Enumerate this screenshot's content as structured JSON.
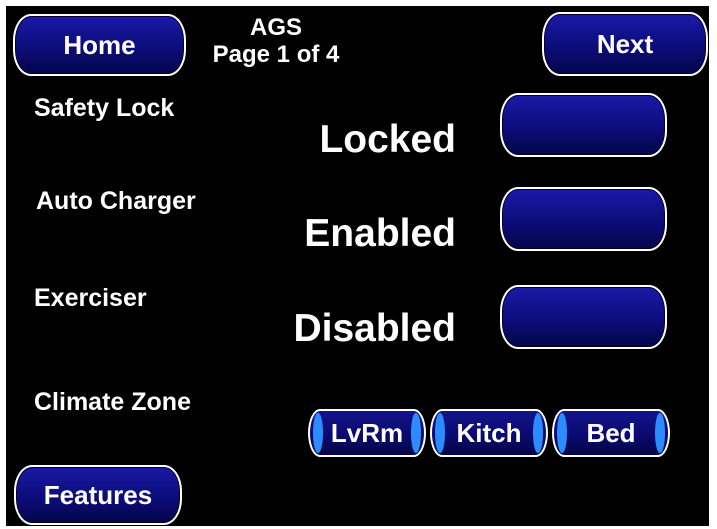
{
  "header": {
    "title": "AGS",
    "page_indicator": "Page 1 of 4",
    "home_label": "Home",
    "next_label": "Next"
  },
  "settings": [
    {
      "label": "Safety Lock",
      "status": "Locked"
    },
    {
      "label": "Auto Charger",
      "status": "Enabled"
    },
    {
      "label": "Exerciser",
      "status": "Disabled"
    }
  ],
  "climate": {
    "label": "Climate Zone",
    "zones": [
      "LvRm",
      "Kitch",
      "Bed"
    ]
  },
  "footer": {
    "features_label": "Features"
  },
  "colors": {
    "background": "#000000",
    "button_blue": "#0c0c7a",
    "zone_accent": "#2a8cff",
    "text": "#ffffff"
  }
}
